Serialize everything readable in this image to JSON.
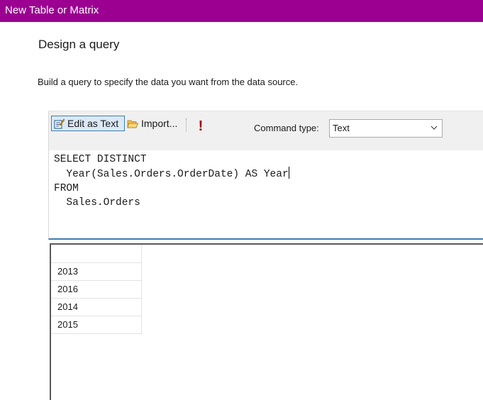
{
  "window": {
    "title": "New Table or Matrix"
  },
  "page": {
    "heading": "Design a query",
    "description": "Build a query to specify the data you want from the data source."
  },
  "toolbar": {
    "edit_as_text_label": "Edit as Text",
    "import_label": "Import...",
    "run_icon": "exclamation-icon",
    "command_type_label": "Command type:",
    "command_type_value": "Text"
  },
  "editor": {
    "lines": [
      "SELECT DISTINCT",
      "  Year(Sales.Orders.OrderDate) AS Year",
      "FROM",
      "  Sales.Orders"
    ]
  },
  "results": {
    "columns": [
      ""
    ],
    "rows": [
      "2013",
      "2016",
      "2014",
      "2015"
    ]
  },
  "colors": {
    "title_bar": "#9b0091",
    "splitter": "#3e7cb5",
    "run_icon": "#a10000"
  }
}
